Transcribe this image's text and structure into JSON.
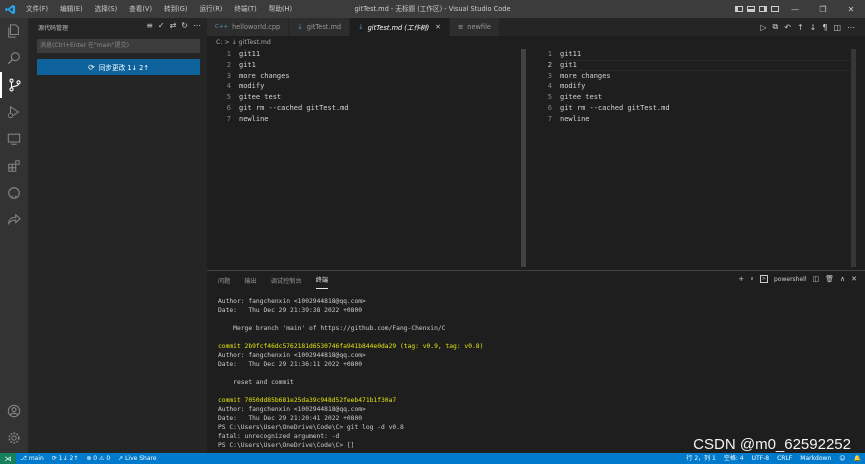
{
  "titlebar": {
    "menu": [
      "文件(F)",
      "编辑(E)",
      "选择(S)",
      "查看(V)",
      "转到(G)",
      "运行(R)",
      "终端(T)",
      "帮助(H)"
    ],
    "title": "gitTest.md - 无标题 (工作区) - Visual Studio Code"
  },
  "sidebar": {
    "header": "源代码管理",
    "input_placeholder": "消息(Ctrl+Enter 在\"main\"提交)",
    "sync_label": "同步更改 1↓ 2↑"
  },
  "tabs": [
    {
      "icon": "C++",
      "label": "helloworld.cpp"
    },
    {
      "icon": "↓",
      "label": "gitTest.md"
    },
    {
      "icon": "↓",
      "label": "gitTest.md (工作树)"
    },
    {
      "icon": "≡",
      "label": "newfile"
    }
  ],
  "breadcrumb": "C: > ↓ gitTest.md",
  "diff_left": [
    {
      "n": "1",
      "t": "git11"
    },
    {
      "n": "2",
      "t": "git1"
    },
    {
      "n": "3",
      "t": "more changes"
    },
    {
      "n": "4",
      "t": "modify"
    },
    {
      "n": "5",
      "t": "gitee test"
    },
    {
      "n": "6",
      "t": "git rm --cached gitTest.md"
    },
    {
      "n": "7",
      "t": "newline"
    }
  ],
  "diff_right": [
    {
      "n": "1",
      "t": "git11"
    },
    {
      "n": "2",
      "t": "git1"
    },
    {
      "n": "3",
      "t": "more changes"
    },
    {
      "n": "4",
      "t": "modify"
    },
    {
      "n": "5",
      "t": "gitee test"
    },
    {
      "n": "6",
      "t": "git rm --cached gitTest.md"
    },
    {
      "n": "7",
      "t": "newline"
    }
  ],
  "panel": {
    "tabs": [
      "问题",
      "输出",
      "调试控制台",
      "终端"
    ],
    "shell": "powershell"
  },
  "terminal": [
    {
      "c": "",
      "t": "Author: fangchenxin <1002944818@qq.com>"
    },
    {
      "c": "",
      "t": "Date:   Thu Dec 29 21:39:38 2022 +0800"
    },
    {
      "c": "",
      "t": ""
    },
    {
      "c": "",
      "t": "    Merge branch 'main' of https://github.com/Fang-Chenxin/C"
    },
    {
      "c": "",
      "t": ""
    },
    {
      "c": "y",
      "t": "commit 2b9fcf46dc5762181d6530746fa941b844e0da29 (tag: v0.9, tag: v0.8)"
    },
    {
      "c": "",
      "t": "Author: fangchenxin <1002944818@qq.com>"
    },
    {
      "c": "",
      "t": "Date:   Thu Dec 29 21:36:11 2022 +0800"
    },
    {
      "c": "",
      "t": ""
    },
    {
      "c": "",
      "t": "    reset and commit"
    },
    {
      "c": "",
      "t": ""
    },
    {
      "c": "y",
      "t": "commit 7050dd85b681e25da39c948d52feeb471b1f30a7"
    },
    {
      "c": "",
      "t": "Author: fangchenxin <1002944818@qq.com>"
    },
    {
      "c": "",
      "t": "Date:   Thu Dec 29 21:20:41 2022 +0800"
    },
    {
      "c": "",
      "t": "PS C:\\Users\\User\\OneDrive\\Code\\C> git log -d v0.8"
    },
    {
      "c": "",
      "t": "fatal: unrecognized argument: -d"
    },
    {
      "c": "",
      "t": "PS C:\\Users\\User\\OneDrive\\Code\\C> []"
    }
  ],
  "statusbar": {
    "branch": "main",
    "sync": "1↓ 2↑",
    "problems": "⊗ 0 ⚠ 0",
    "live_share": "Live Share",
    "position": "行 2，列 1",
    "spaces": "空格: 4",
    "encoding": "UTF-8",
    "eol": "CRLF",
    "language": "Markdown"
  },
  "watermark": "CSDN @m0_62592252"
}
